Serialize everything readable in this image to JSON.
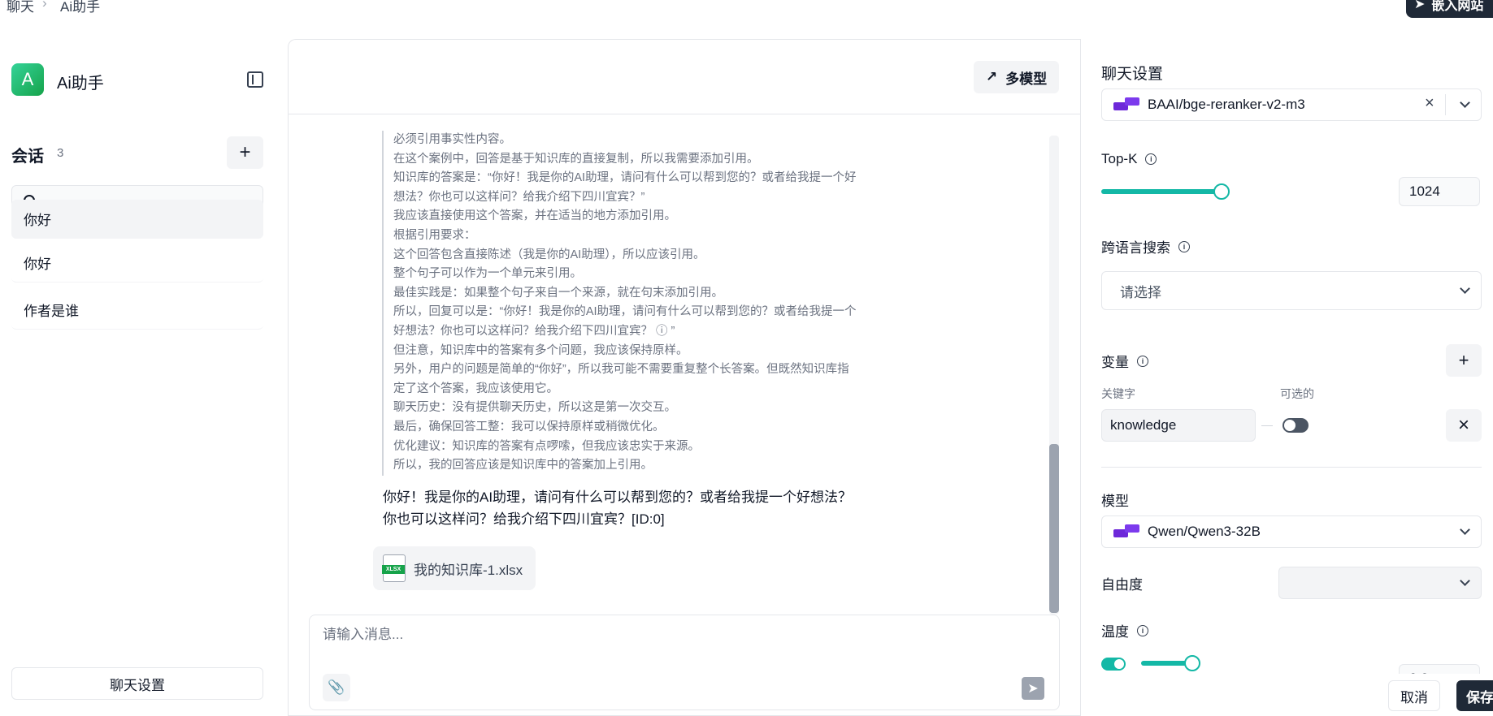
{
  "breadcrumb": {
    "root": "聊天",
    "separator": "›",
    "current": "Ai助手"
  },
  "embed_button": "嵌入网站",
  "sidebar": {
    "logo_letter": "A",
    "app_name": "Ai助手",
    "sessions_title": "会话",
    "sessions_count": "3",
    "add_icon": "+",
    "search_placeholder": "",
    "sessions": [
      {
        "label": "你好"
      },
      {
        "label": "你好"
      },
      {
        "label": "作者是谁"
      }
    ],
    "chat_settings_button": "聊天设置"
  },
  "chat": {
    "multi_model_button": "多模型",
    "thinking_lines": [
      "必须引用事实性内容。",
      "在这个案例中，回答是基于知识库的直接复制，所以我需要添加引用。",
      "知识库的答案是：“你好！我是你的AI助理，请问有什么可以帮到您的？或者给我提一个好",
      "想法？你也可以这样问？给我介绍下四川宜宾？”",
      "我应该直接使用这个答案，并在适当的地方添加引用。",
      "根据引用要求：",
      "这个回答包含直接陈述（我是你的AI助理），所以应该引用。",
      "整个句子可以作为一个单元来引用。",
      "最佳实践是：如果整个句子来自一个来源，就在句末添加引用。",
      "所以，回复可以是：“你好！我是你的AI助理，请问有什么可以帮到您的？或者给我提一个",
      "好想法？你也可以这样问？给我介绍下四川宜宾？ ⓘ ”",
      "但注意，知识库中的答案有多个问题，我应该保持原样。",
      "另外，用户的问题是简单的“你好”，所以我可能不需要重复整个长答案。但既然知识库指",
      "定了这个答案，我应该使用它。",
      "聊天历史：没有提供聊天历史，所以这是第一次交互。",
      "最后，确保回答工整：我可以保持原样或稍微优化。",
      "优化建议：知识库的答案有点啰嗦，但我应该忠实于来源。",
      "所以，我的回答应该是知识库中的答案加上引用。"
    ],
    "answer_lines": [
      "你好！我是你的AI助理，请问有什么可以帮到您的？或者给我提一个好想法？",
      "你也可以这样问？给我介绍下四川宜宾？[ID:0]"
    ],
    "file_icon_text": "XLSX",
    "file_name": "我的知识库-1.xlsx",
    "input_placeholder": "请输入消息..."
  },
  "settings": {
    "title": "聊天设置",
    "reranker_model": "BAAI/bge-reranker-v2-m3",
    "topk_label": "Top-K",
    "topk_value": "1024",
    "topk_fraction": 0.32,
    "cross_lang_label": "跨语言搜索",
    "cross_lang_placeholder": "请选择",
    "variables_label": "变量",
    "keyword_label": "关键字",
    "optional_label": "可选的",
    "keyword_value": "knowledge",
    "model_label": "模型",
    "model_value": "Qwen/Qwen3-32B",
    "freedom_label": "自由度",
    "temperature_label": "温度",
    "temperature_value": "0.2",
    "cancel_button": "取消",
    "save_button": "保存",
    "accent_color": "#14b8a6"
  }
}
